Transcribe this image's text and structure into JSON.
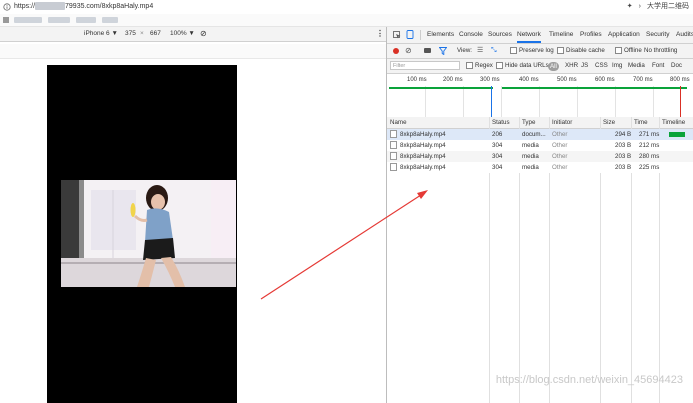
{
  "address_bar": {
    "url_prefix": "https://",
    "url_suffix": "79935.com/8xkp8aHaly.mp4",
    "right_text": "大学用二维码"
  },
  "device_toolbar": {
    "device": "iPhone 6 ▼",
    "width": "375",
    "times": "×",
    "height": "667",
    "zoom": "100% ▼"
  },
  "devtools": {
    "tabs": [
      "Elements",
      "Console",
      "Sources",
      "Network",
      "Timeline",
      "Profiles",
      "Application",
      "Security",
      "Audits"
    ],
    "active_tab": "Network",
    "toolbar": {
      "view_label": "View:",
      "preserve_log": "Preserve log",
      "disable_cache": "Disable cache",
      "offline": "Offline",
      "throttling": "No throttling"
    },
    "filter": {
      "placeholder": "Filter",
      "regex": "Regex",
      "hide_data_urls": "Hide data URLs",
      "types": [
        "All",
        "XHR",
        "JS",
        "CSS",
        "Img",
        "Media",
        "Font",
        "Doc"
      ]
    },
    "timeline_ticks": [
      "100 ms",
      "200 ms",
      "300 ms",
      "400 ms",
      "500 ms",
      "600 ms",
      "700 ms",
      "800 ms"
    ],
    "columns": [
      "Name",
      "Status",
      "Type",
      "Initiator",
      "Size",
      "Time",
      "Timeline"
    ],
    "rows": [
      {
        "name": "8xkp8aHaly.mp4",
        "status": "206",
        "type": "docum...",
        "initiator": "Other",
        "size": "294 B",
        "time": "271 ms"
      },
      {
        "name": "8xkp8aHaly.mp4",
        "status": "304",
        "type": "media",
        "initiator": "Other",
        "size": "203 B",
        "time": "212 ms"
      },
      {
        "name": "8xkp8aHaly.mp4",
        "status": "304",
        "type": "media",
        "initiator": "Other",
        "size": "203 B",
        "time": "280 ms"
      },
      {
        "name": "8xkp8aHaly.mp4",
        "status": "304",
        "type": "media",
        "initiator": "Other",
        "size": "203 B",
        "time": "225 ms"
      }
    ]
  },
  "watermark": "https://blog.csdn.net/weixin_45694423",
  "colors": {
    "accent": "#1a73e8",
    "record": "#d93025",
    "timeline_bar": "#0aa33a",
    "annotation_arrow": "#e53935"
  }
}
